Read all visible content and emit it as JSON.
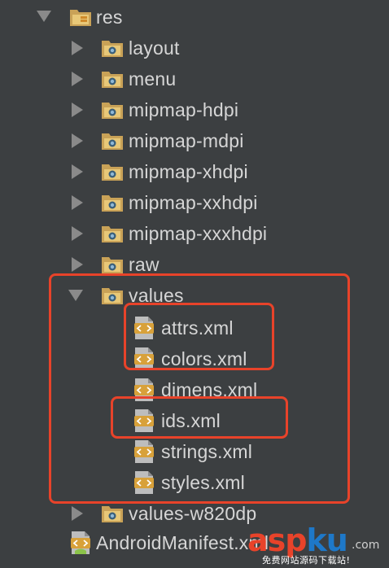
{
  "tree": {
    "root": {
      "label": "res"
    },
    "folders": [
      {
        "label": "layout",
        "state": "collapsed"
      },
      {
        "label": "menu",
        "state": "collapsed"
      },
      {
        "label": "mipmap-hdpi",
        "state": "collapsed"
      },
      {
        "label": "mipmap-mdpi",
        "state": "collapsed"
      },
      {
        "label": "mipmap-xhdpi",
        "state": "collapsed"
      },
      {
        "label": "mipmap-xxhdpi",
        "state": "collapsed"
      },
      {
        "label": "mipmap-xxxhdpi",
        "state": "collapsed"
      },
      {
        "label": "raw",
        "state": "collapsed"
      },
      {
        "label": "values",
        "state": "expanded"
      }
    ],
    "values_files": [
      {
        "label": "attrs.xml"
      },
      {
        "label": "colors.xml"
      },
      {
        "label": "dimens.xml"
      },
      {
        "label": "ids.xml"
      },
      {
        "label": "strings.xml"
      },
      {
        "label": "styles.xml"
      }
    ],
    "after_folders": [
      {
        "label": "values-w820dp",
        "state": "collapsed"
      }
    ],
    "manifest": {
      "label": "AndroidManifest.xml"
    }
  },
  "watermark": {
    "asp": "asp",
    "ku": "ku",
    "com": ".com",
    "subtitle": "免费网站源码下载站!"
  },
  "colors": {
    "background": "#3c3f41",
    "highlight": "#e8432a",
    "folder": "#c9a257",
    "xml_icon": "#d8a13a"
  }
}
